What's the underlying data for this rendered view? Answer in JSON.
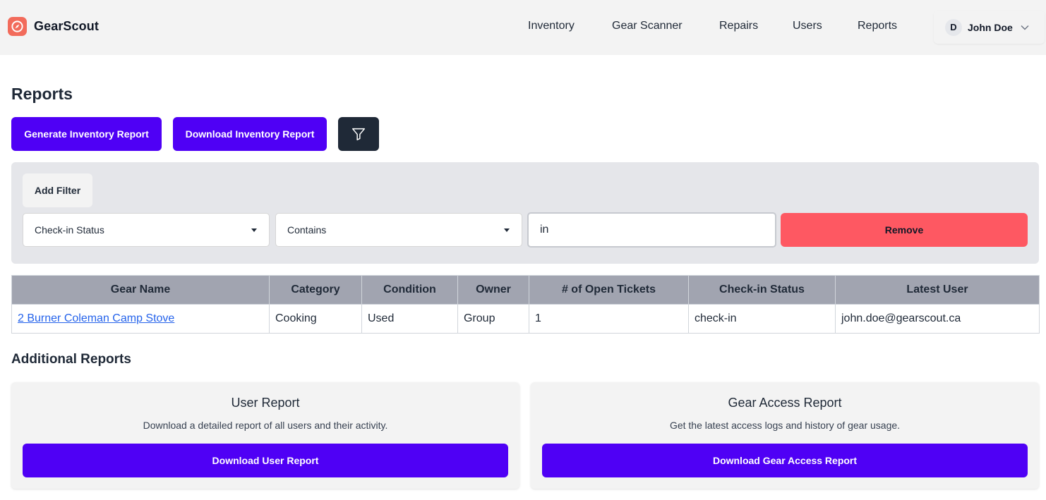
{
  "app": {
    "name": "GearScout",
    "logo_icon": "compass-icon",
    "brand_color": "#f26b5b"
  },
  "nav": {
    "items": [
      "Inventory",
      "Gear Scanner",
      "Repairs",
      "Users",
      "Reports"
    ]
  },
  "user": {
    "initial": "D",
    "name": "John Doe"
  },
  "page": {
    "title": "Reports"
  },
  "actions": {
    "generate_label": "Generate Inventory Report",
    "download_label": "Download Inventory Report",
    "filter_icon": "filter-icon",
    "primary_color": "#4f00f5"
  },
  "filter": {
    "add_label": "Add Filter",
    "field_value": "Check-in Status",
    "operator_value": "Contains",
    "text_value": "in",
    "remove_label": "Remove",
    "remove_color": "#fe5862"
  },
  "table": {
    "headers": [
      "Gear Name",
      "Category",
      "Condition",
      "Owner",
      "# of Open Tickets",
      "Check-in Status",
      "Latest User"
    ],
    "rows": [
      [
        "2 Burner Coleman Camp Stove",
        "Cooking",
        "Used",
        "Group",
        "1",
        "check-in",
        "john.doe@gearscout.ca"
      ]
    ]
  },
  "additional": {
    "title": "Additional Reports",
    "cards": [
      {
        "title": "User Report",
        "description": "Download a detailed report of all users and their activity.",
        "button": "Download User Report"
      },
      {
        "title": "Gear Access Report",
        "description": "Get the latest access logs and history of gear usage.",
        "button": "Download Gear Access Report"
      }
    ]
  }
}
